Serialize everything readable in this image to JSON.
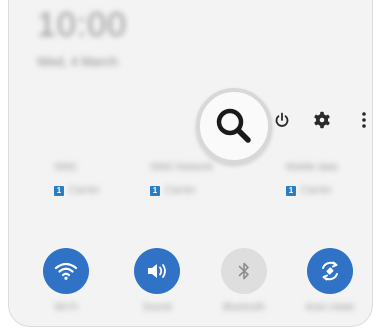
{
  "header": {
    "time": "10:00",
    "date": "Wed, 4 March"
  },
  "header_icons": {
    "search": "search-icon",
    "power": "power-icon",
    "settings": "gear-icon",
    "more": "more-options-icon"
  },
  "sims": [
    {
      "name": "SIM1",
      "badge": "1",
      "carrier": "Carrier"
    },
    {
      "name": "SIM2 Network",
      "badge": "1",
      "carrier": "Carrier"
    },
    {
      "name": "Mobile data",
      "badge": "1",
      "carrier": "Carrier"
    }
  ],
  "tiles": [
    {
      "label": "Wi-Fi",
      "icon": "wifi-icon",
      "state": "on"
    },
    {
      "label": "Sound",
      "icon": "sound-icon",
      "state": "on"
    },
    {
      "label": "Bluetooth",
      "icon": "bluetooth-icon",
      "state": "off"
    },
    {
      "label": "Auto rotate",
      "icon": "auto-rotate-icon",
      "state": "on"
    }
  ],
  "colors": {
    "accent": "#2f72c6",
    "sim_badge": "#2a7fc4",
    "inactive_tile": "#dedede"
  }
}
